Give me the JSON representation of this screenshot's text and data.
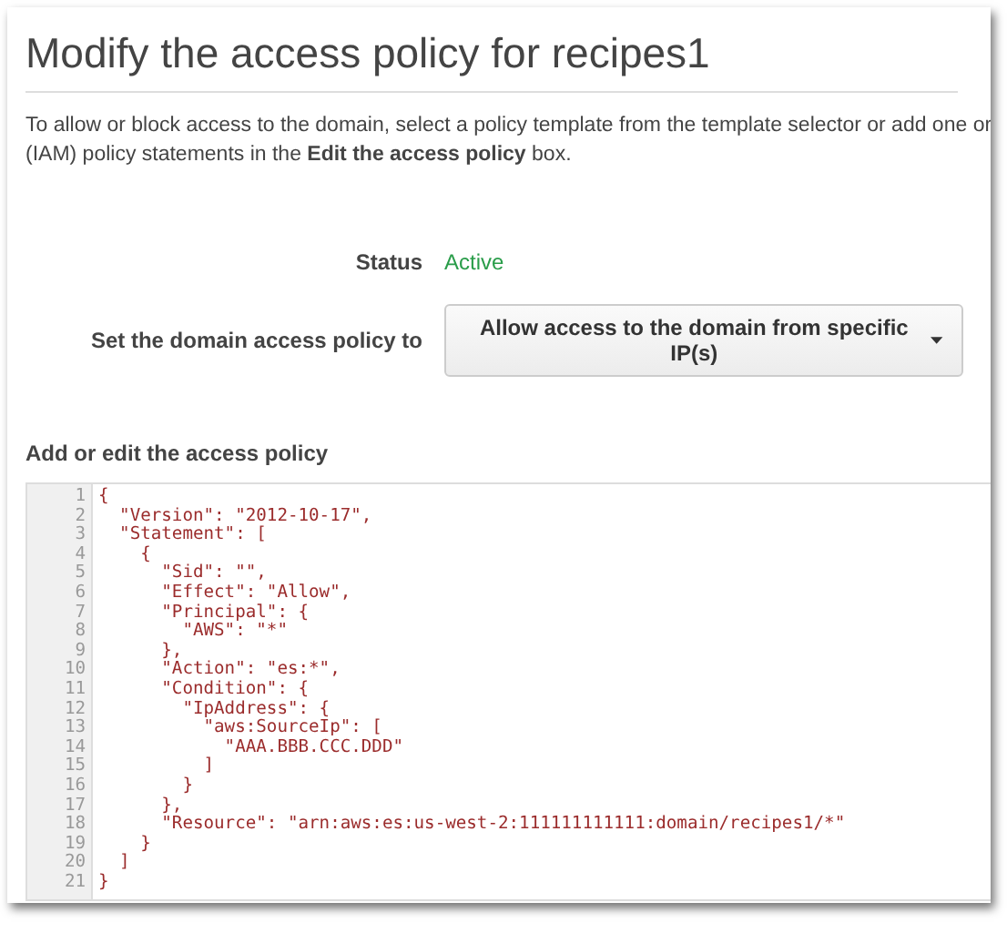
{
  "title": "Modify the access policy for recipes1",
  "description": [
    "To allow or block access to the domain, select a policy template from the template selector or add one or",
    "(IAM) policy statements in the **Edit the access policy** box."
  ],
  "status": {
    "label": "Status",
    "value": "Active"
  },
  "policy_select": {
    "label": "Set the domain access policy to",
    "value": "Allow access to the domain from specific IP(s)"
  },
  "editor": {
    "label": "Add or edit the access policy",
    "lines": [
      {
        "number": "1",
        "text": "{"
      },
      {
        "number": "2",
        "text": "  \"Version\": \"2012-10-17\","
      },
      {
        "number": "3",
        "text": "  \"Statement\": ["
      },
      {
        "number": "4",
        "text": "    {"
      },
      {
        "number": "5",
        "text": "      \"Sid\": \"\","
      },
      {
        "number": "6",
        "text": "      \"Effect\": \"Allow\","
      },
      {
        "number": "7",
        "text": "      \"Principal\": {"
      },
      {
        "number": "8",
        "text": "        \"AWS\": \"*\""
      },
      {
        "number": "9",
        "text": "      },"
      },
      {
        "number": "10",
        "text": "      \"Action\": \"es:*\","
      },
      {
        "number": "11",
        "text": "      \"Condition\": {"
      },
      {
        "number": "12",
        "text": "        \"IpAddress\": {"
      },
      {
        "number": "13",
        "text": "          \"aws:SourceIp\": ["
      },
      {
        "number": "14",
        "text": "            \"AAA.BBB.CCC.DDD\""
      },
      {
        "number": "15",
        "text": "          ]"
      },
      {
        "number": "16",
        "text": "        }"
      },
      {
        "number": "17",
        "text": "      },"
      },
      {
        "number": "18",
        "text": "      \"Resource\": \"arn:aws:es:us-west-2:111111111111:domain/recipes1/*\""
      },
      {
        "number": "19",
        "text": "    }"
      },
      {
        "number": "20",
        "text": "  ]"
      },
      {
        "number": "21",
        "text": "}"
      }
    ]
  }
}
